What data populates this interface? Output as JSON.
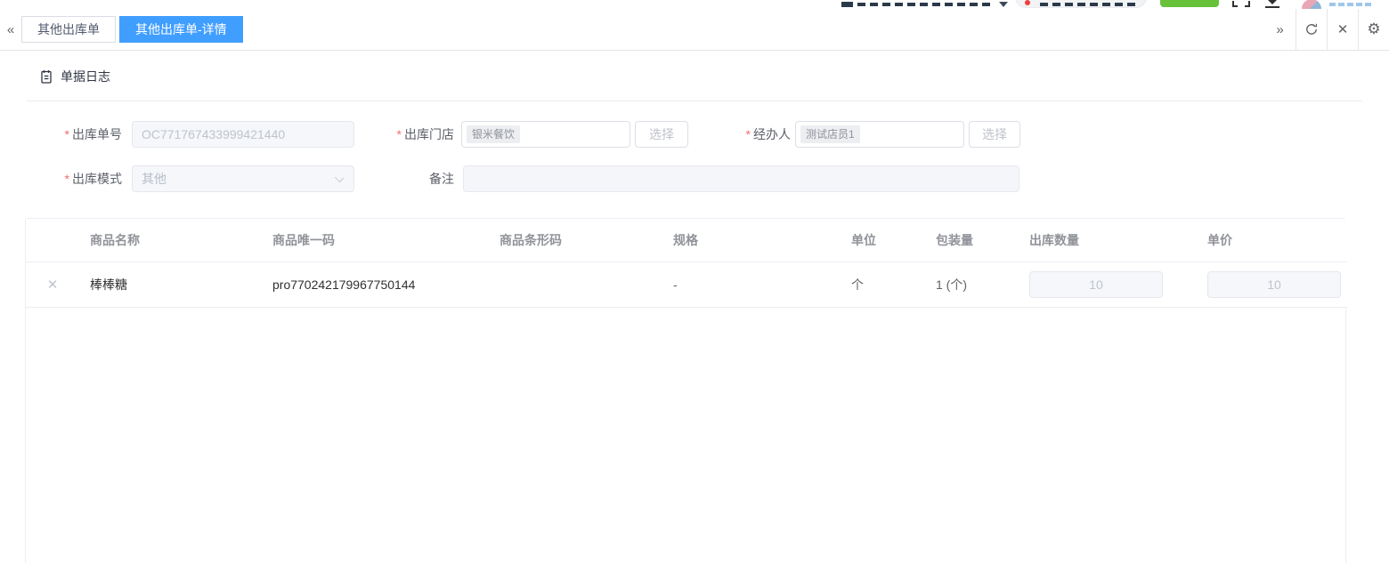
{
  "tab_bar": {
    "collapse_icon": "«",
    "expand_icon": "»",
    "close_icon": "✕",
    "gear_icon": "⚙",
    "tabs": [
      {
        "label": "其他出库单",
        "active": false
      },
      {
        "label": "其他出库单-详情",
        "active": true
      }
    ]
  },
  "toolbar": {
    "log_button_label": "单据日志"
  },
  "form": {
    "required_marker": "*",
    "order_no": {
      "label": "出库单号",
      "value": "OC771767433999421440"
    },
    "store": {
      "label": "出库门店",
      "tag": "银米餐饮",
      "button": "选择"
    },
    "operator": {
      "label": "经办人",
      "tag": "测试店员1",
      "button": "选择"
    },
    "mode": {
      "label": "出库模式",
      "value": "其他"
    },
    "remark": {
      "label": "备注",
      "value": ""
    }
  },
  "table": {
    "headers": {
      "name": "商品名称",
      "unique_code": "商品唯一码",
      "barcode": "商品条形码",
      "spec": "规格",
      "unit": "单位",
      "package": "包装量",
      "quantity": "出库数量",
      "price": "单价"
    },
    "row": {
      "delete_icon": "✕",
      "name": "棒棒糖",
      "unique_code": "pro770242179967750144",
      "barcode": "",
      "spec": "-",
      "unit": "个",
      "package": "1 (个)",
      "quantity": "10",
      "price": "10"
    }
  },
  "colors": {
    "primary_blue": "#409EFF",
    "success_green": "#67C23A",
    "required_red": "#F56C6C",
    "notification_dot_red": "#F03E3E"
  }
}
